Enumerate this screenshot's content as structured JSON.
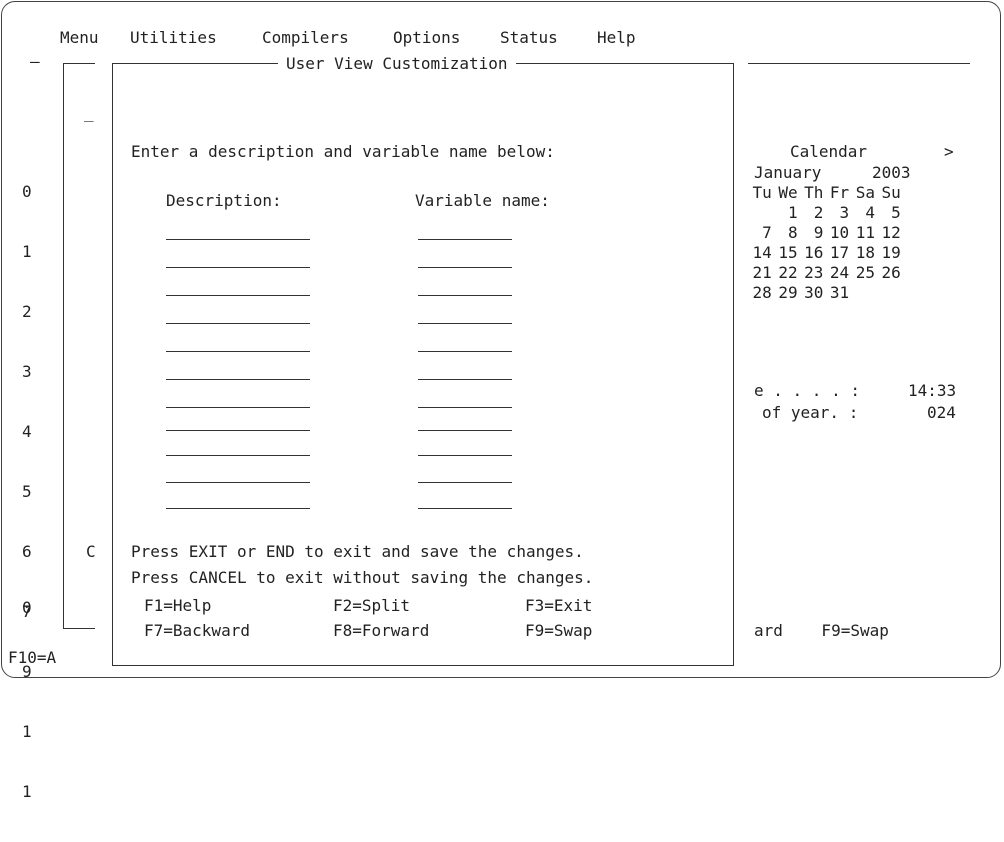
{
  "menubar": [
    "Menu",
    "Utilities",
    "Compilers",
    "Options",
    "Status",
    "Help"
  ],
  "dialog": {
    "title": "User View Customization",
    "prompt": "Enter a description and variable name below:",
    "description_header": "Description:",
    "variable_header": "Variable name:",
    "footer_line1": "Press EXIT or END to exit and save the changes.",
    "footer_line2": "Press CANCEL to exit without saving the changes.",
    "fkeys_row1": [
      "F1=Help",
      "F2=Split",
      "F3=Exit"
    ],
    "fkeys_row2": [
      "F7=Backward",
      "F8=Forward",
      "F9=Swap"
    ]
  },
  "left_gutter": [
    "0",
    "1",
    "2",
    "3",
    "4",
    "5",
    "6",
    "7",
    "9",
    "1",
    "1"
  ],
  "underlying": {
    "cursor": "_",
    "c_marker": "C",
    "zero_marker": "0",
    "bottom_left": "F10=A",
    "dash_left": "–",
    "bottom_right": "ard    F9=Swap"
  },
  "calendar": {
    "title": "Calendar",
    "next_arrow": ">",
    "month": "January",
    "year": "2003",
    "weekdays": [
      "Tu",
      "We",
      "Th",
      "Fr",
      "Sa",
      "Su"
    ],
    "weeks": [
      [
        "",
        "1",
        "2",
        "3",
        "4",
        "5"
      ],
      [
        "7",
        "8",
        "9",
        "10",
        "11",
        "12"
      ],
      [
        "14",
        "15",
        "16",
        "17",
        "18",
        "19"
      ],
      [
        "21",
        "22",
        "23",
        "24",
        "25",
        "26"
      ],
      [
        "28",
        "29",
        "30",
        "31",
        "",
        ""
      ]
    ],
    "time_label": "e . . . . :",
    "time_value": "14:33",
    "day_label": "of year. :",
    "day_value": "024"
  }
}
